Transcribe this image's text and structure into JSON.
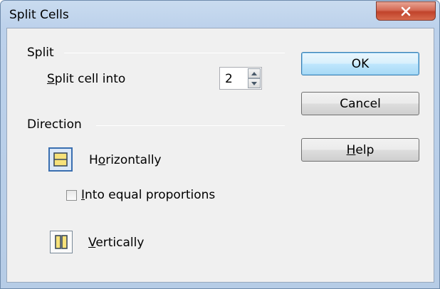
{
  "window": {
    "title": "Split Cells"
  },
  "split_group": {
    "label": "Split",
    "split_cell_into_label": "Split cell into",
    "split_cell_into_value": "2"
  },
  "direction_group": {
    "label": "Direction",
    "horizontally_label": "Horizontally",
    "equal_proportions_label": "Into equal proportions",
    "equal_proportions_checked": false,
    "vertically_label": "Vertically",
    "selected": "Horizontally"
  },
  "buttons": {
    "ok": "OK",
    "cancel": "Cancel",
    "help": "Help"
  },
  "colors": {
    "accent": "#3a6fb0",
    "icon_fill": "#f7e27a",
    "close_red": "#c0432b"
  }
}
